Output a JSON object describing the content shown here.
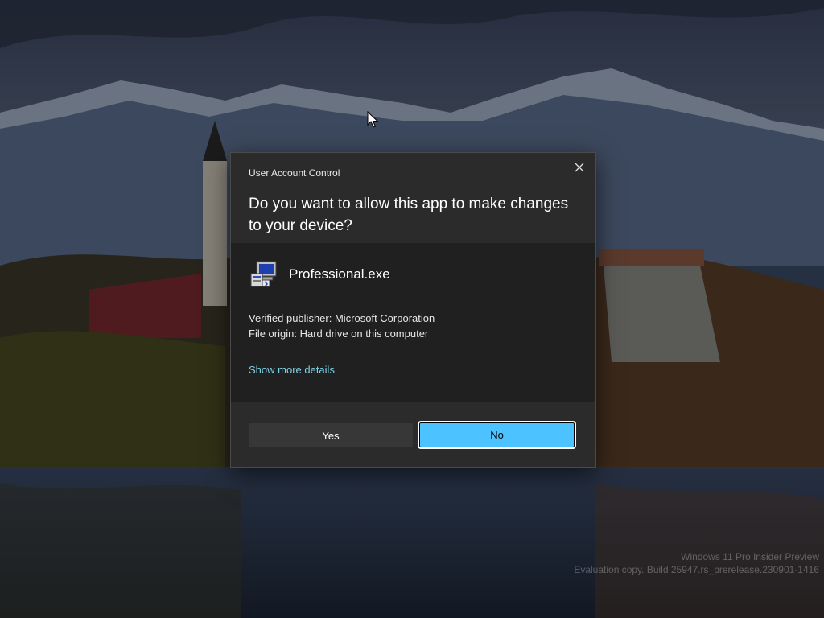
{
  "dialog": {
    "caption": "User Account Control",
    "question": "Do you want to allow this app to make changes to your device?",
    "app_name": "Professional.exe",
    "publisher": "Verified publisher: Microsoft Corporation",
    "file_origin": "File origin: Hard drive on this computer",
    "details_link": "Show more details",
    "yes_label": "Yes",
    "no_label": "No",
    "accent_color": "#4cc2ff",
    "link_color": "#7fd3e8"
  },
  "desktop": {
    "watermark_line1": "Windows 11 Pro Insider Preview",
    "watermark_line2": "Evaluation copy. Build 25947.rs_prerelease.230901-1416"
  },
  "icons": {
    "close": "close-icon",
    "app": "installer-app-icon",
    "cursor": "mouse-pointer-icon"
  }
}
